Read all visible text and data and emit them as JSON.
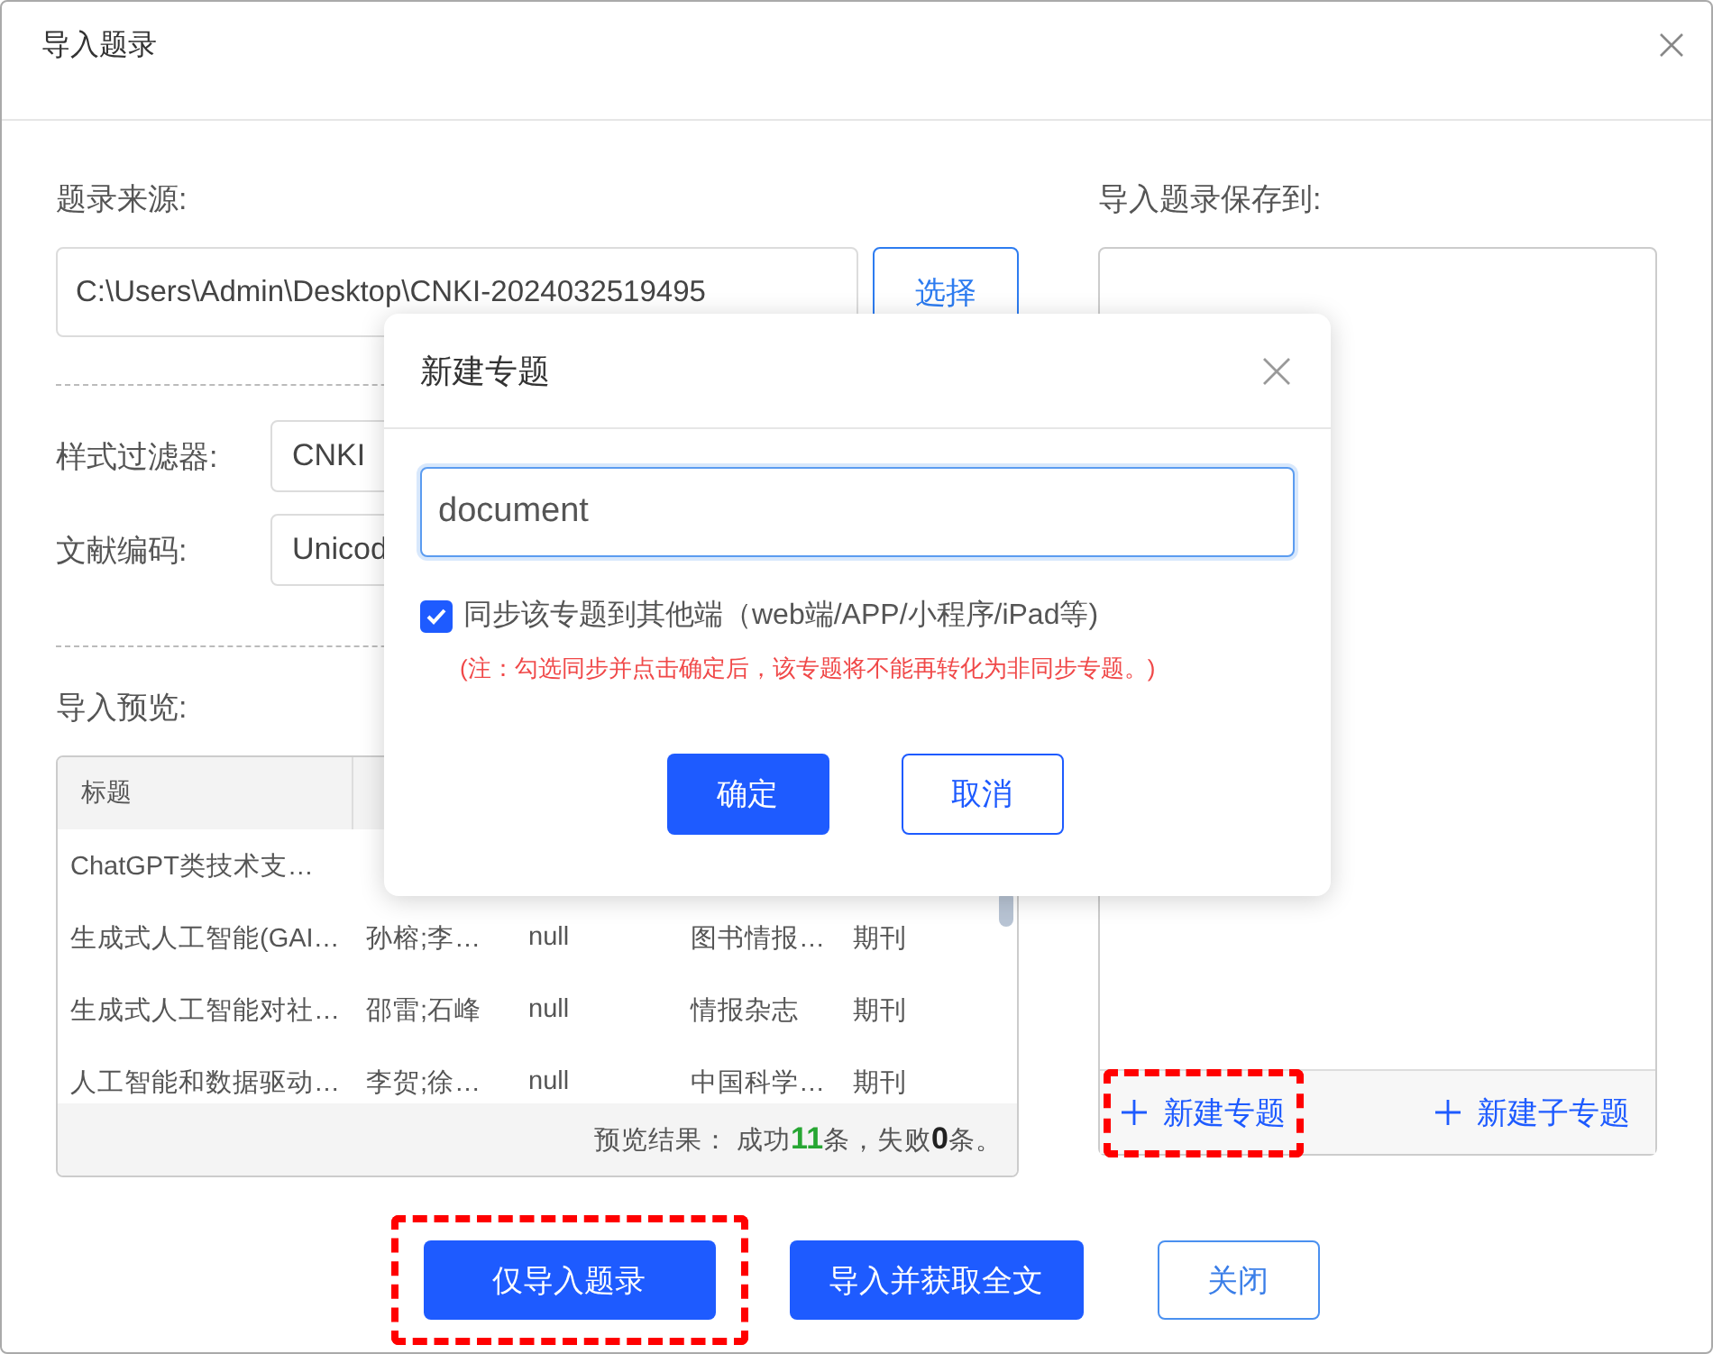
{
  "window": {
    "title": "导入题录"
  },
  "source": {
    "label": "题录来源:",
    "value": "C:\\Users\\Admin\\Desktop\\CNKI-2024032519495",
    "button": "选择"
  },
  "filter": {
    "label": "样式过滤器:",
    "value": "CNKI"
  },
  "encoding": {
    "label": "文献编码:",
    "value": "Unicod"
  },
  "preview": {
    "label": "导入预览:",
    "columns": [
      "标题"
    ],
    "rows": [
      {
        "cells": [
          "ChatGPT类技术支…"
        ]
      },
      {
        "cells": [
          "生成式人工智能(GAI…",
          "孙榕;李…",
          "null",
          "图书情报…",
          "期刊"
        ]
      },
      {
        "cells": [
          "生成式人工智能对社…",
          "邵雷;石峰",
          "null",
          "情报杂志",
          "期刊"
        ]
      },
      {
        "cells": [
          "人工智能和数据驱动…",
          "李贺;徐…",
          "null",
          "中国科学…",
          "期刊"
        ]
      }
    ],
    "summary": {
      "label": "预览结果：",
      "before": "成功",
      "success": "11",
      "middle": "条，失败",
      "fail": "0",
      "after": "条。"
    }
  },
  "save_to": {
    "label": "导入题录保存到:",
    "actions": [
      {
        "label": "新建专题",
        "highlighted": true
      },
      {
        "label": "新建子专题",
        "highlighted": false
      }
    ]
  },
  "buttons": [
    {
      "label": "仅导入题录",
      "kind": "primary",
      "highlighted": true
    },
    {
      "label": "导入并获取全文",
      "kind": "primary",
      "highlighted": false
    },
    {
      "label": "关闭",
      "kind": "plain",
      "highlighted": false
    }
  ],
  "dialog": {
    "title": "新建专题",
    "input_value": "document",
    "sync": {
      "label": "同步该专题到其他端（web端/APP/小程序/iPad等)",
      "checked": true
    },
    "note": "(注：勾选同步并点击确定后，该专题将不能再转化为非同步专题。)",
    "buttons": [
      {
        "label": "确定",
        "kind": "primary"
      },
      {
        "label": "取消",
        "kind": "outline"
      }
    ]
  }
}
